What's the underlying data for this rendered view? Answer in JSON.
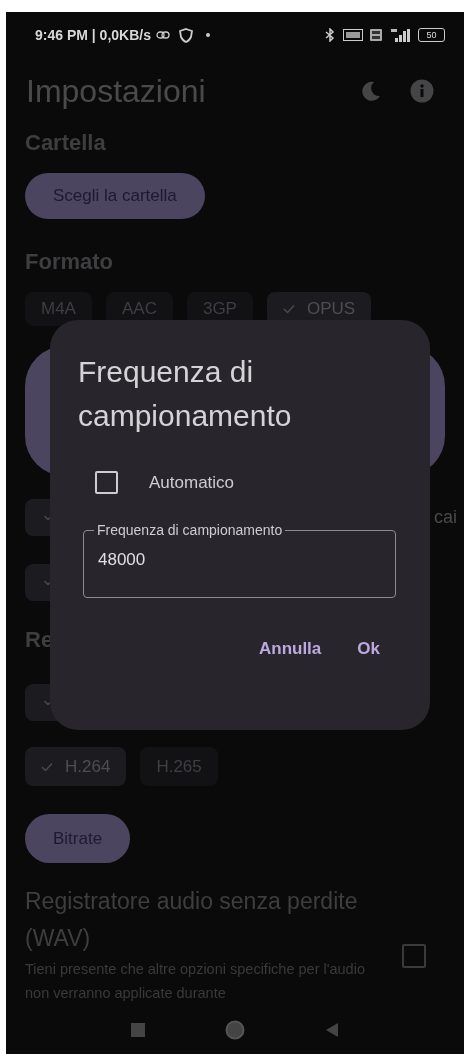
{
  "status_bar": {
    "time": "9:46 PM | 0,0KB/s",
    "battery": "50"
  },
  "header": {
    "title": "Impostazioni"
  },
  "folder": {
    "heading": "Cartella",
    "button": "Scegli la cartella"
  },
  "format": {
    "heading": "Formato",
    "chips": [
      {
        "label": "M4A",
        "selected": false
      },
      {
        "label": "AAC",
        "selected": false
      },
      {
        "label": "3GP",
        "selected": false
      },
      {
        "label": "OPUS",
        "selected": true
      }
    ]
  },
  "covered": {
    "option_rows": [
      {
        "selected": true
      },
      {
        "selected": true
      }
    ],
    "trailing_text": "cai",
    "heading": "Re",
    "row_after_heading": {
      "selected": true
    }
  },
  "encoder": {
    "chips": [
      {
        "label": "H.264",
        "selected": true
      },
      {
        "label": "H.265",
        "selected": false
      }
    ]
  },
  "bitrate": {
    "button": "Bitrate"
  },
  "wav": {
    "title": "Registratore audio senza perdite (WAV)",
    "description": "Tieni presente che altre opzioni specifiche per l'audio non verranno applicate durante",
    "checked": false
  },
  "dialog": {
    "title": "Frequenza di campionamento",
    "checkbox": {
      "label": "Automatico",
      "checked": false
    },
    "field": {
      "label": "Frequenza di campionamento",
      "value": "48000"
    },
    "buttons": [
      "Annulla",
      "Ok"
    ]
  }
}
